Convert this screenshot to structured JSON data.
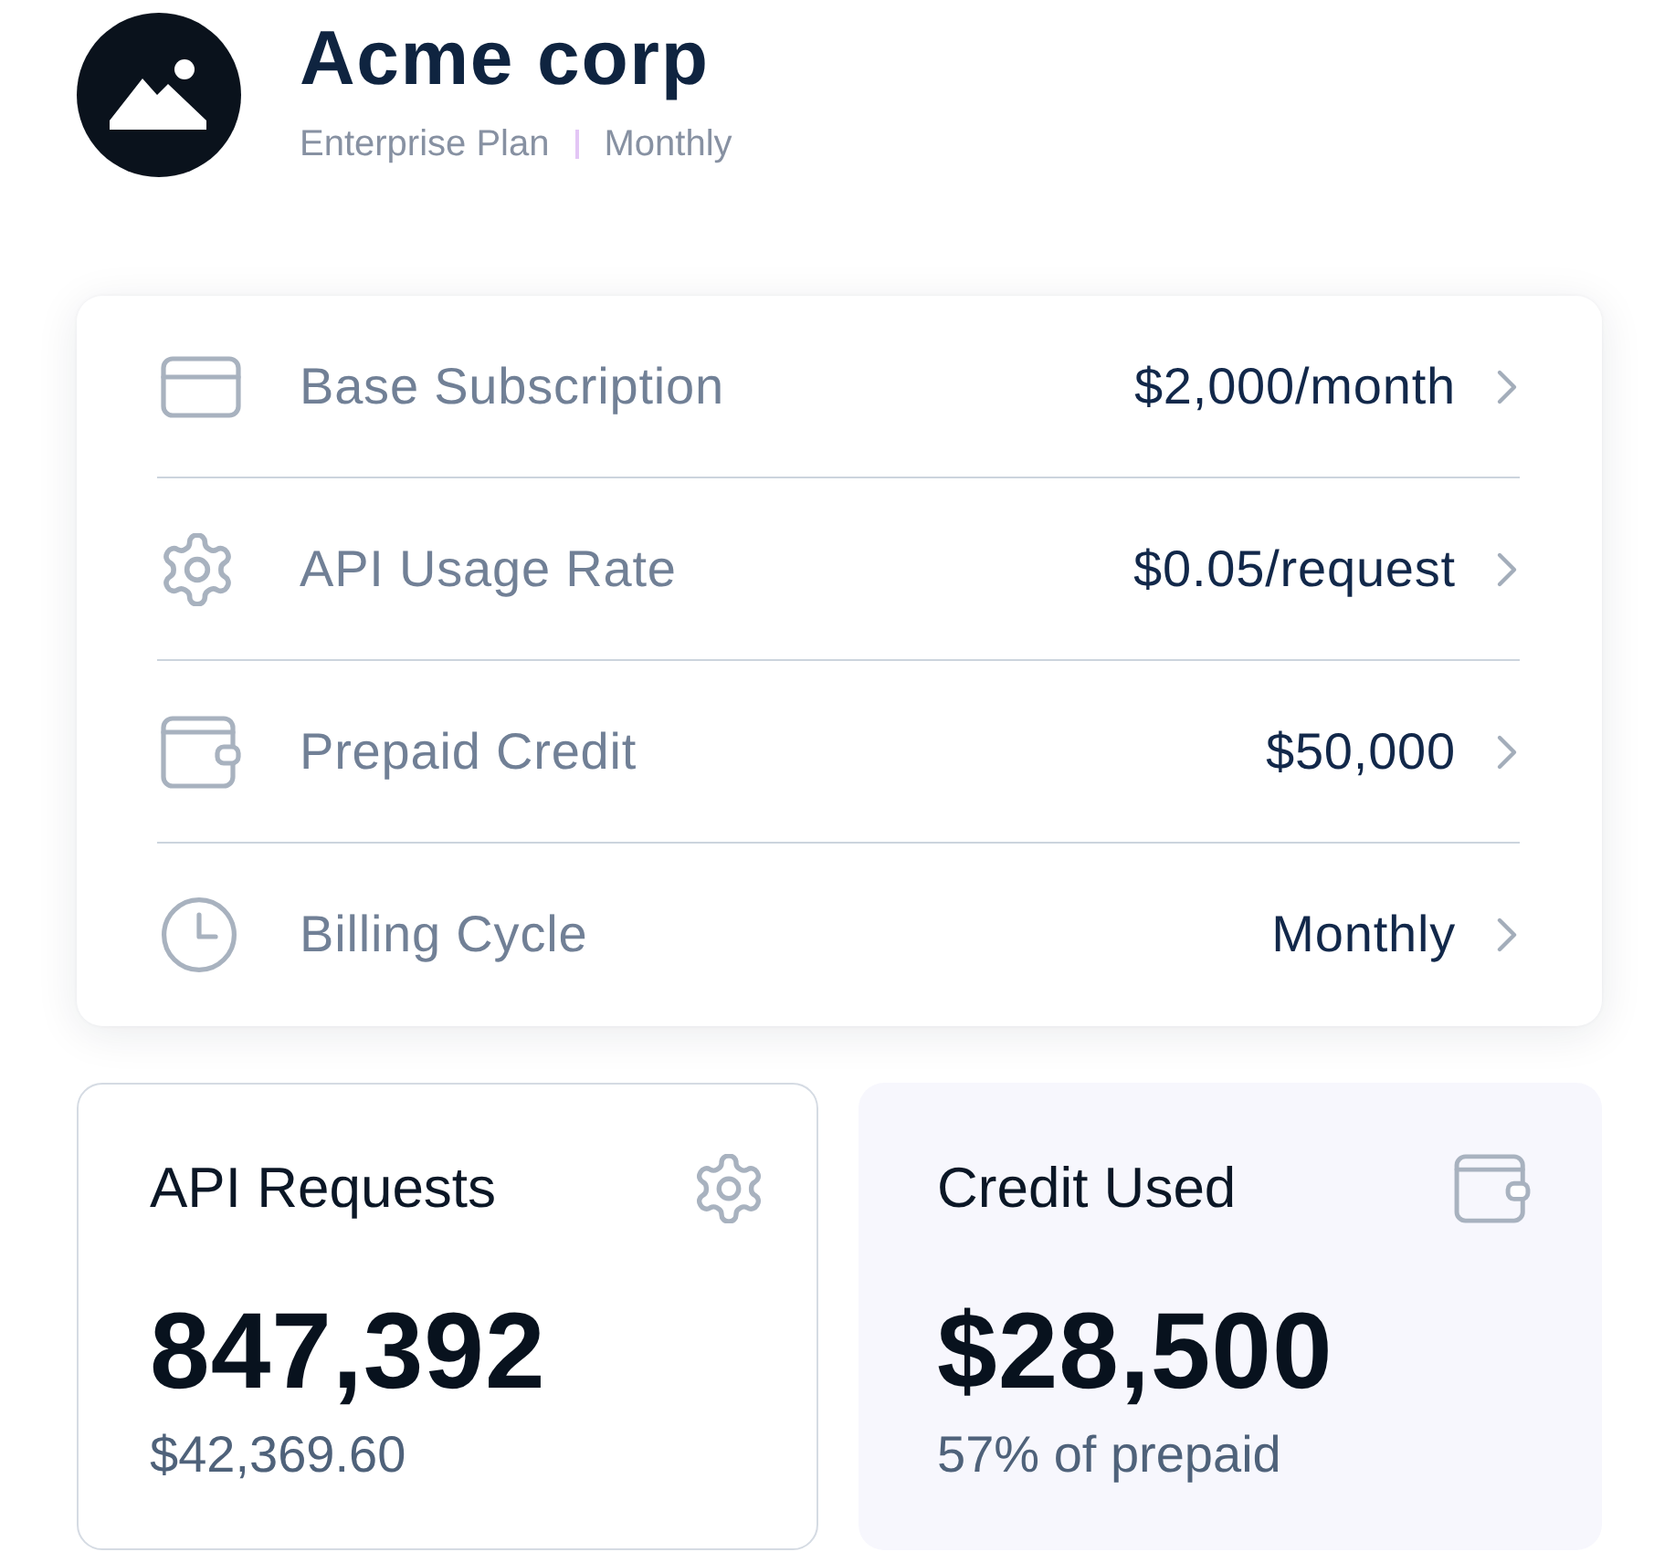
{
  "header": {
    "title": "Acme corp",
    "plan": "Enterprise Plan",
    "billing_period": "Monthly"
  },
  "billing_items": [
    {
      "label": "Base Subscription",
      "value": "$2,000/month"
    },
    {
      "label": "API Usage Rate",
      "value": "$0.05/request"
    },
    {
      "label": "Prepaid Credit",
      "value": "$50,000"
    },
    {
      "label": "Billing Cycle",
      "value": "Monthly"
    }
  ],
  "stat_cards": [
    {
      "kind": "outlined",
      "title": "API Requests",
      "value": "847,392",
      "detail": "$42,369.60"
    },
    {
      "kind": "tinted",
      "title": "Credit Used",
      "value": "$28,500",
      "detail": "57% of prepaid"
    }
  ]
}
